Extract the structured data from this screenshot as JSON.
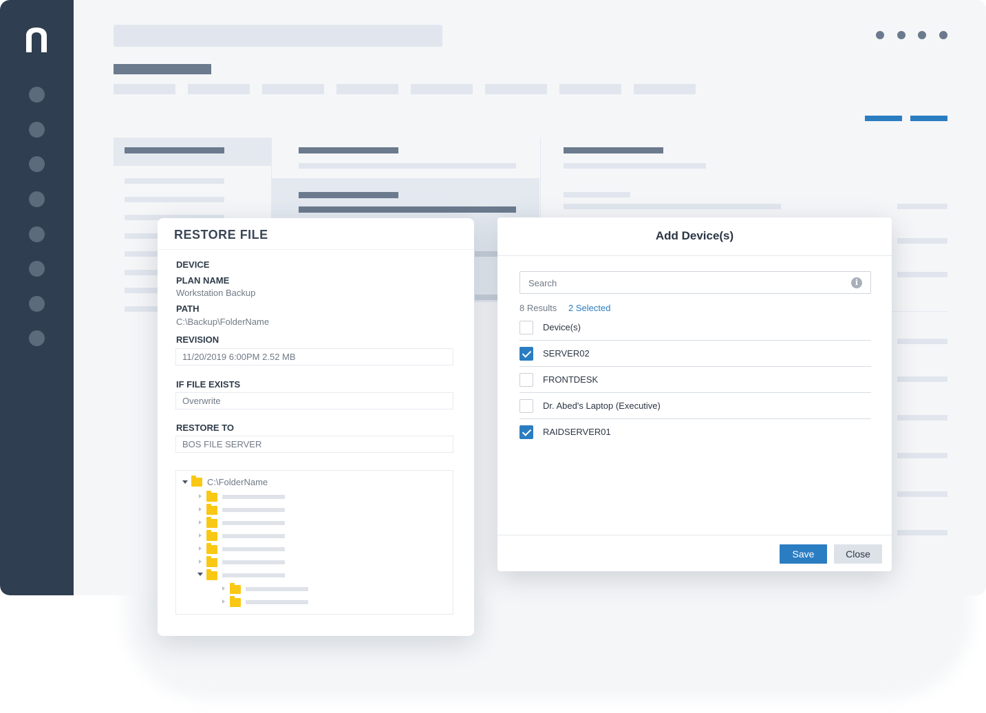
{
  "app": {
    "logo_icon": "n-logo-icon",
    "brand_color": "#2f3f51",
    "accent_color": "#2b7dc2"
  },
  "restore_file": {
    "title": "RESTORE FILE",
    "device_label": "DEVICE",
    "plan_name_label": "PLAN NAME",
    "plan_name_value": "Workstation Backup",
    "path_label": "PATH",
    "path_value": "C:\\Backup\\FolderName",
    "revision_label": "REVISION",
    "revision_value": "11/20/2019 6:00PM 2.52 MB",
    "if_file_exists_label": "IF FILE EXISTS",
    "if_file_exists_value": "Overwrite",
    "restore_to_label": "RESTORE TO",
    "restore_to_value": "BOS FILE SERVER",
    "tree_root": "C:\\FolderName"
  },
  "add_devices": {
    "title": "Add Device(s)",
    "search_placeholder": "Search",
    "results_text": "8 Results",
    "selected_text": "2 Selected",
    "header_label": "Device(s)",
    "devices": [
      {
        "label": "SERVER02",
        "checked": true
      },
      {
        "label": "FRONTDESK",
        "checked": false
      },
      {
        "label": "Dr. Abed's Laptop (Executive)",
        "checked": false
      },
      {
        "label": "RAIDSERVER01",
        "checked": true
      }
    ],
    "save_label": "Save",
    "close_label": "Close"
  }
}
